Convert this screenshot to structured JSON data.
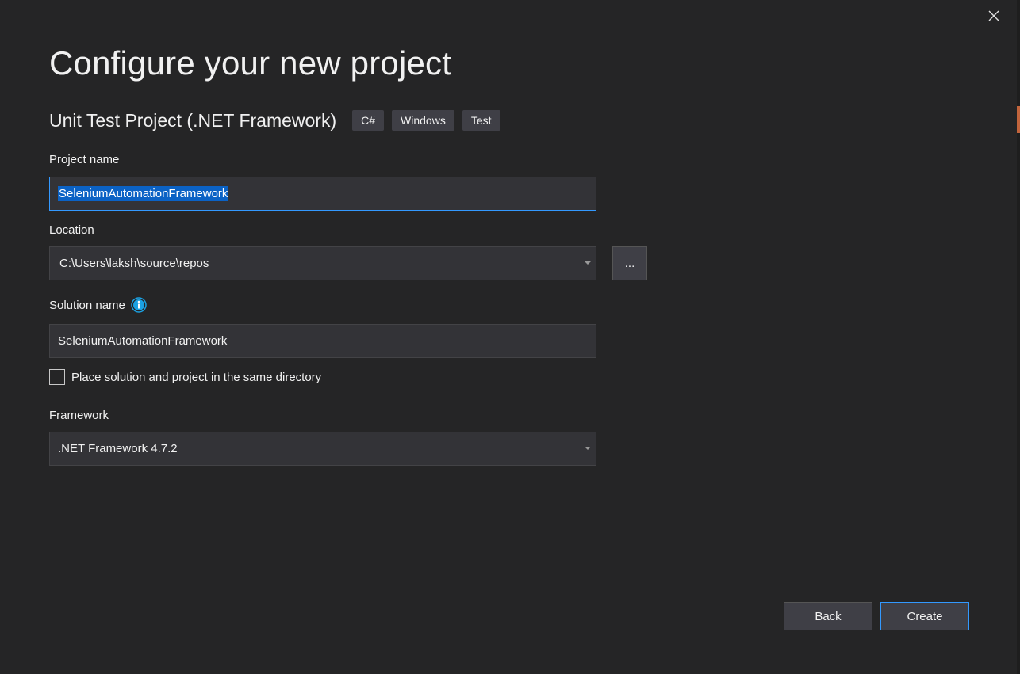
{
  "dialog": {
    "title": "Configure your new project",
    "template": {
      "name": "Unit Test Project (.NET Framework)",
      "tags": [
        "C#",
        "Windows",
        "Test"
      ]
    }
  },
  "form": {
    "project_name": {
      "label": "Project name",
      "value": "SeleniumAutomationFramework"
    },
    "location": {
      "label": "Location",
      "value": "C:\\Users\\laksh\\source\\repos",
      "browse_label": "..."
    },
    "solution_name": {
      "label": "Solution name",
      "value": "SeleniumAutomationFramework",
      "info_icon": "info-icon"
    },
    "same_directory": {
      "label": "Place solution and project in the same directory",
      "checked": false
    },
    "framework": {
      "label": "Framework",
      "value": ".NET Framework 4.7.2"
    }
  },
  "buttons": {
    "back": "Back",
    "create": "Create"
  },
  "colors": {
    "background": "#252526",
    "field": "#333337",
    "accent": "#3399ff",
    "selection": "#0b62c5",
    "info": "#1ba1e2"
  }
}
